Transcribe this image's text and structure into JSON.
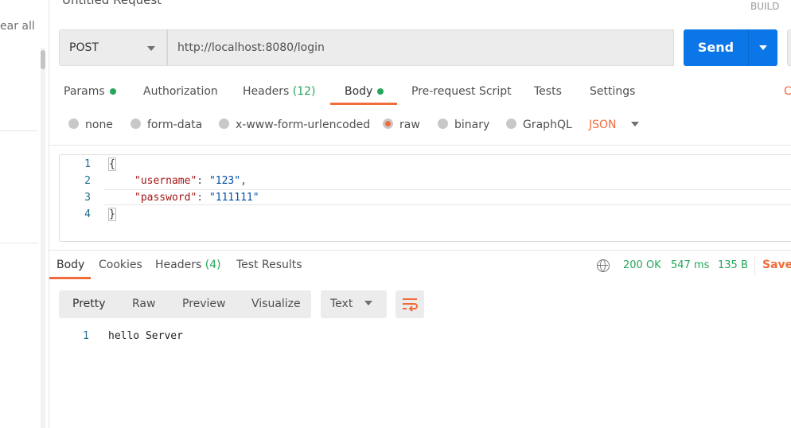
{
  "title": "Untitled Request",
  "build_label": "BUILD",
  "sidebar": {
    "clear_all": "ear all"
  },
  "request": {
    "method": "POST",
    "url": "http://localhost:8080/login",
    "send": "Send"
  },
  "tabs": [
    {
      "label": "Params"
    },
    {
      "label": "Authorization"
    },
    {
      "label": "Headers",
      "count": "(12)"
    },
    {
      "label": "Body"
    },
    {
      "label": "Pre-request Script"
    },
    {
      "label": "Tests"
    },
    {
      "label": "Settings"
    }
  ],
  "cookies_cut": "C",
  "body_types": [
    "none",
    "form-data",
    "x-www-form-urlencoded",
    "raw",
    "binary",
    "GraphQL"
  ],
  "body_format": "JSON",
  "editor": {
    "lines": [
      {
        "n": "1",
        "text": "{"
      },
      {
        "n": "2",
        "key": "\"username\"",
        "val": "\"123\""
      },
      {
        "n": "3",
        "key": "\"password\"",
        "val": "\"111111\""
      },
      {
        "n": "4",
        "text": "}"
      }
    ]
  },
  "response": {
    "tabs": [
      {
        "label": "Body"
      },
      {
        "label": "Cookies"
      },
      {
        "label": "Headers",
        "count": "(4)"
      },
      {
        "label": "Test Results"
      }
    ],
    "status": "200 OK",
    "time": "547 ms",
    "size": "135 B",
    "save": "Save",
    "views": [
      "Pretty",
      "Raw",
      "Preview",
      "Visualize"
    ],
    "format": "Text",
    "lines": [
      {
        "n": "1",
        "text": "hello Server"
      }
    ]
  },
  "colors": {
    "accent": "#f26b3a",
    "send": "#0b76e8",
    "green": "#26a65b"
  }
}
